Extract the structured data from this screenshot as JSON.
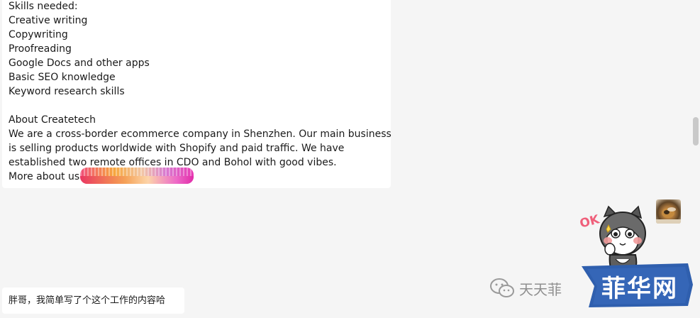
{
  "message": {
    "lines": [
      "Skills needed:",
      "Creative writing",
      "Copywriting",
      "Proofreading",
      "Google Docs and other apps",
      "Basic SEO knowledge",
      "Keyword  research skills",
      "",
      "About Createtech",
      "We are a cross-border ecommerce company in Shenzhen. Our main business",
      "is selling products worldwide with Shopify and paid traffic. We have",
      "established two remote offices in CDO and Bohol with good vibes.",
      "More about us:"
    ]
  },
  "reply": {
    "text": "胖哥，我简单写了个这个工作的内容哈"
  },
  "sticker": {
    "label": "OK"
  },
  "watermark": {
    "text": "天天菲"
  },
  "logo": {
    "text": "菲华网"
  },
  "colors": {
    "background": "#f5f5f5",
    "bubble": "#ffffff",
    "logo_blue": "#2f5fae",
    "sticker_ok": "#ef5f7a"
  },
  "icons": [
    "wechat-icon",
    "avatar",
    "ok-sticker"
  ]
}
